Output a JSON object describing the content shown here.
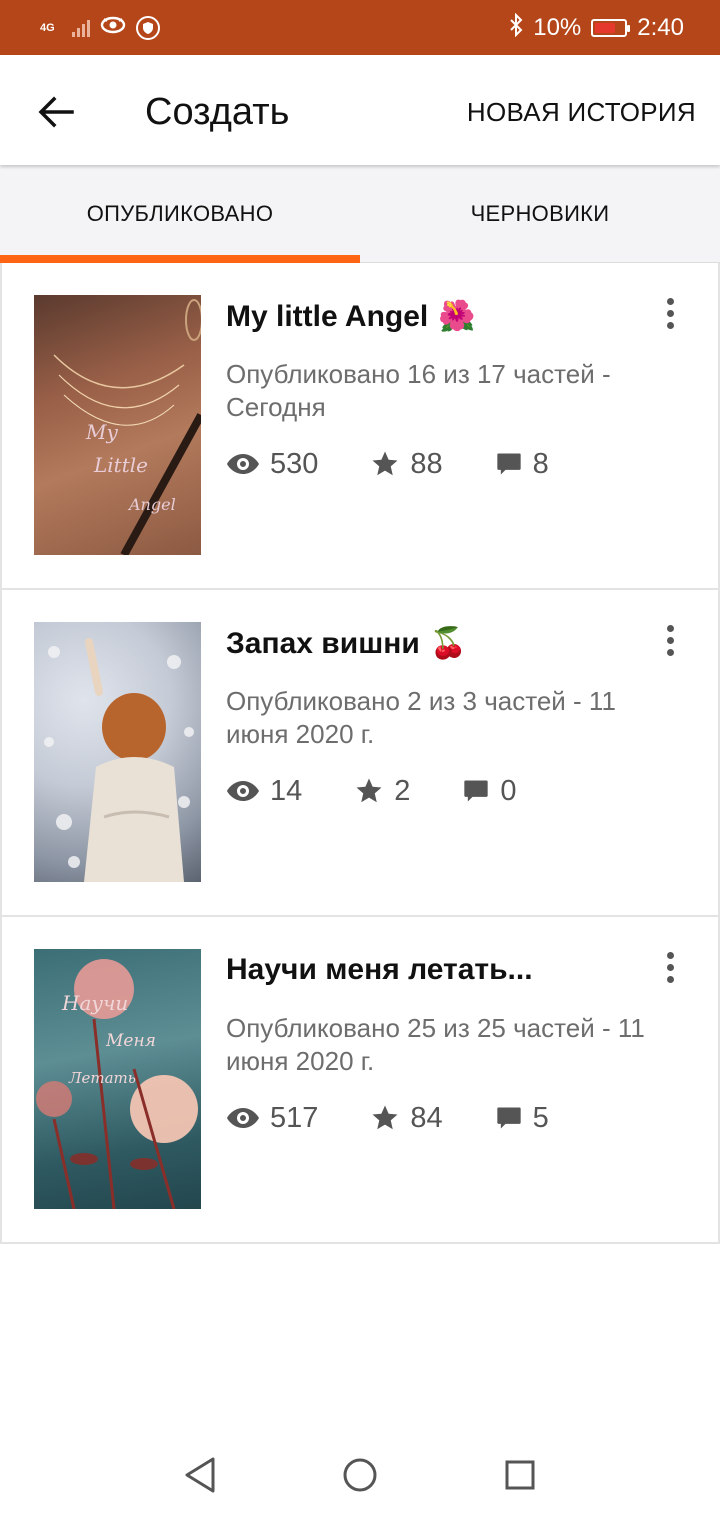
{
  "status_bar": {
    "network": "4G",
    "battery_percent": "10%",
    "time": "2:40",
    "icons": [
      "signal-icon",
      "eye-icon",
      "shield-icon",
      "bluetooth-icon",
      "battery-icon"
    ]
  },
  "app_bar": {
    "back_icon": "arrow-back-icon",
    "title": "Создать",
    "action_label": "НОВАЯ ИСТОРИЯ"
  },
  "tabs": [
    {
      "label": "ОПУБЛИКОВАНО",
      "active": true
    },
    {
      "label": "ЧЕРНОВИКИ",
      "active": false
    }
  ],
  "accent_color": "#ff6414",
  "status_bar_color": "#b5461a",
  "stories": [
    {
      "title": "My little Angel",
      "emoji": "🌺",
      "meta": "Опубликовано 16 из 17 частей - Сегодня",
      "views": "530",
      "votes": "88",
      "comments": "8",
      "cover_text": [
        "My",
        "Little",
        "Angel"
      ]
    },
    {
      "title": "Запах вишни",
      "emoji": "🍒",
      "meta": "Опубликовано 2 из 3 частей - 11 июня 2020 г.",
      "views": "14",
      "votes": "2",
      "comments": "0",
      "cover_text": []
    },
    {
      "title": "Научи меня летать...",
      "emoji": "",
      "meta": "Опубликовано 25 из 25 частей - 11 июня 2020 г.",
      "views": "517",
      "votes": "84",
      "comments": "5",
      "cover_text": [
        "Научи",
        "Меня",
        "Летать"
      ]
    }
  ],
  "nav_bar": {
    "back": "nav-back-icon",
    "home": "nav-home-icon",
    "recents": "nav-recents-icon"
  }
}
